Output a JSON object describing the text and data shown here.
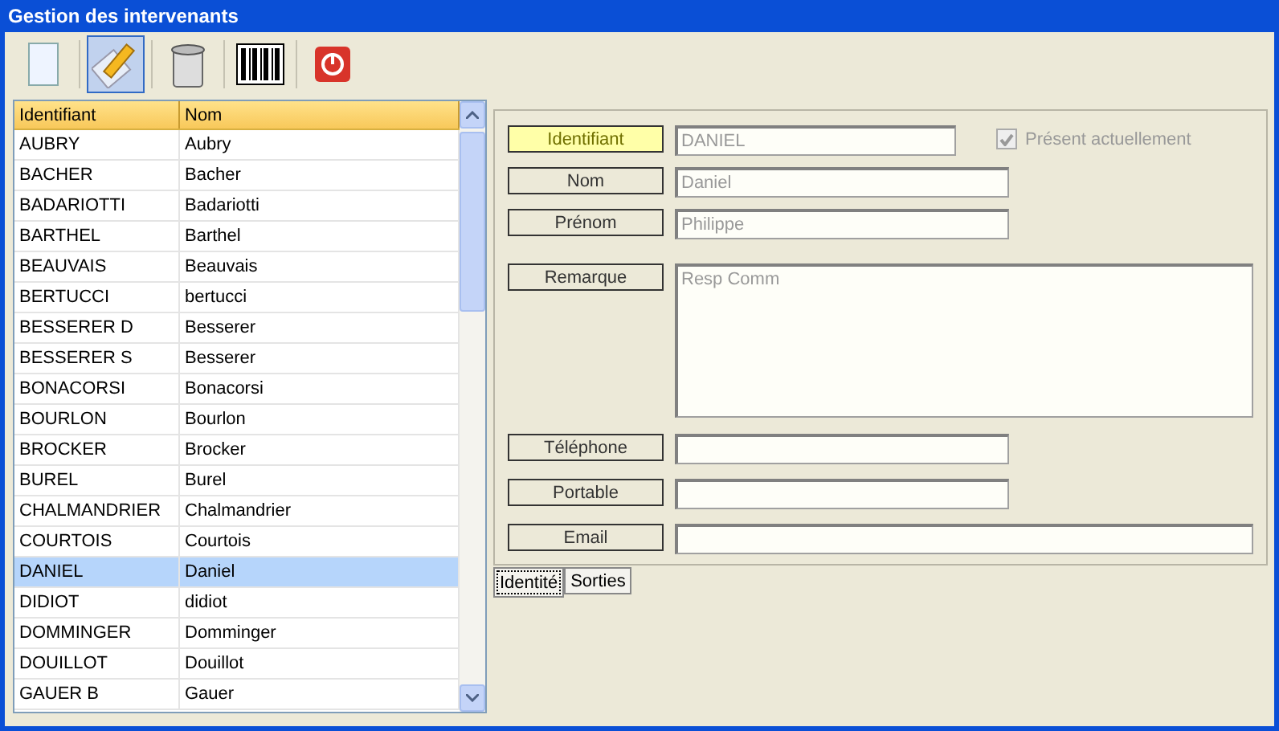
{
  "window": {
    "title": "Gestion des intervenants"
  },
  "toolbar": [
    {
      "kind": "new",
      "pressed": false
    },
    {
      "kind": "edit",
      "pressed": true
    },
    {
      "kind": "trash",
      "pressed": false
    },
    {
      "kind": "barcode",
      "pressed": false
    },
    {
      "kind": "power",
      "pressed": false
    }
  ],
  "table": {
    "columns": [
      "Identifiant",
      "Nom"
    ],
    "rows": [
      {
        "cells": [
          "AUBRY",
          "Aubry"
        ],
        "selected": false
      },
      {
        "cells": [
          "BACHER",
          "Bacher"
        ],
        "selected": false
      },
      {
        "cells": [
          "BADARIOTTI",
          "Badariotti"
        ],
        "selected": false
      },
      {
        "cells": [
          "BARTHEL",
          "Barthel"
        ],
        "selected": false
      },
      {
        "cells": [
          "BEAUVAIS",
          "Beauvais"
        ],
        "selected": false
      },
      {
        "cells": [
          "BERTUCCI",
          "bertucci"
        ],
        "selected": false
      },
      {
        "cells": [
          "BESSERER D",
          "Besserer"
        ],
        "selected": false
      },
      {
        "cells": [
          "BESSERER S",
          "Besserer"
        ],
        "selected": false
      },
      {
        "cells": [
          "BONACORSI",
          "Bonacorsi"
        ],
        "selected": false
      },
      {
        "cells": [
          "BOURLON",
          "Bourlon"
        ],
        "selected": false
      },
      {
        "cells": [
          "BROCKER",
          "Brocker"
        ],
        "selected": false
      },
      {
        "cells": [
          "BUREL",
          "Burel"
        ],
        "selected": false
      },
      {
        "cells": [
          "CHALMANDRIER",
          "Chalmandrier"
        ],
        "selected": false
      },
      {
        "cells": [
          "COURTOIS",
          "Courtois"
        ],
        "selected": false
      },
      {
        "cells": [
          "DANIEL",
          "Daniel"
        ],
        "selected": true
      },
      {
        "cells": [
          "DIDIOT",
          "didiot"
        ],
        "selected": false
      },
      {
        "cells": [
          "DOMMINGER",
          "Domminger"
        ],
        "selected": false
      },
      {
        "cells": [
          "DOUILLOT",
          "Douillot"
        ],
        "selected": false
      },
      {
        "cells": [
          "GAUER B",
          "Gauer"
        ],
        "selected": false
      }
    ]
  },
  "form": {
    "fields": [
      {
        "kind": "short",
        "label": "Identifiant",
        "value": "DANIEL",
        "highlighted": true
      },
      {
        "kind": "medium",
        "label": "Nom",
        "value": "Daniel",
        "highlighted": false
      },
      {
        "kind": "medium",
        "label": "Prénom",
        "value": "Philippe",
        "highlighted": false
      },
      {
        "kind": "multiline",
        "label": "Remarque",
        "value": "Resp Comm",
        "highlighted": false
      },
      {
        "kind": "medium",
        "label": "Téléphone",
        "highlighted": false
      },
      {
        "kind": "medium",
        "label": "Portable",
        "highlighted": false
      },
      {
        "kind": "wide",
        "label": "Email",
        "highlighted": false
      }
    ],
    "present": {
      "label": "Présent actuellement",
      "checked": true
    }
  },
  "tabs": [
    {
      "label": "Identité",
      "selected": true
    },
    {
      "label": "Sorties",
      "selected": false
    }
  ]
}
